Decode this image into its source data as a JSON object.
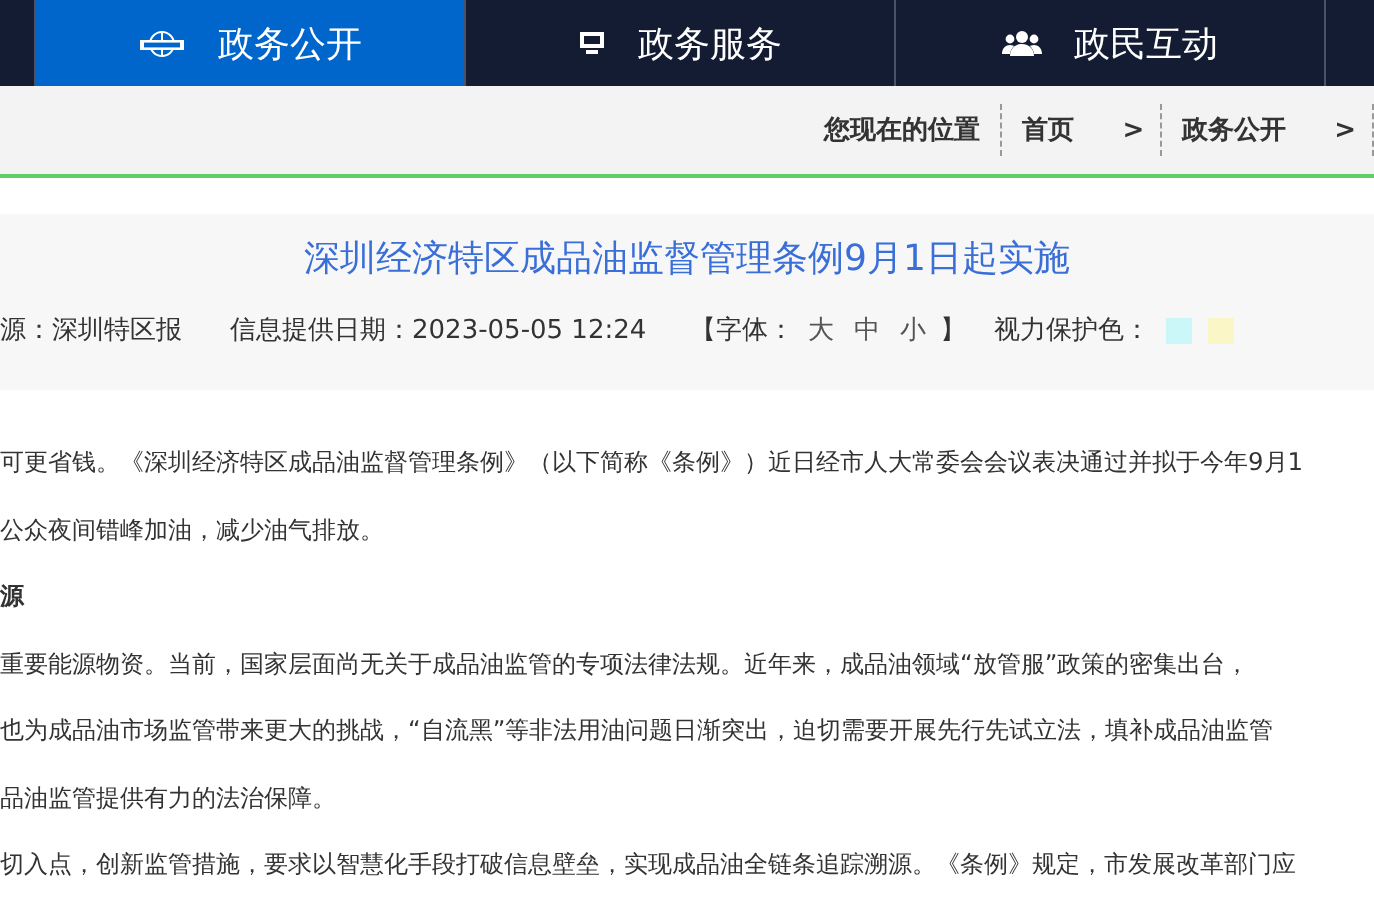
{
  "nav": {
    "tabs": [
      {
        "label": "政务公开",
        "selected": true
      },
      {
        "label": "政务服务",
        "selected": false
      },
      {
        "label": "政民互动",
        "selected": false
      }
    ]
  },
  "breadcrumb": {
    "label": "您现在的位置",
    "items": [
      "首页",
      "政务公开"
    ],
    "separator": ">"
  },
  "article": {
    "title": "深圳经济特区成品油监督管理条例9月1日起实施",
    "source": "源：深圳特区报",
    "date": "信息提供日期：2023-05-05 12:24",
    "font_size": {
      "open": "【字体：",
      "sizes": [
        "大",
        "中",
        "小"
      ],
      "close": "】"
    },
    "eye_care": {
      "label": "视力保护色：",
      "colors": [
        {
          "color": "#ccf7f9"
        },
        {
          "color": "#faf6c6"
        }
      ]
    },
    "paragraphs": [
      {
        "kind": "text",
        "text": "可更省钱。《深圳经济特区成品油监督管理条例》（以下简称《条例》）近日经市人大常委会会议表决通过并拟于今年9月1"
      },
      {
        "kind": "text",
        "text": "公众夜间错峰加油，减少油气排放。"
      },
      {
        "kind": "heading",
        "text": "源"
      },
      {
        "kind": "text",
        "text": "重要能源物资。当前，国家层面尚无关于成品油监管的专项法律法规。近年来，成品油领域“放管服”政策的密集出台，"
      },
      {
        "kind": "text",
        "text": "也为成品油市场监管带来更大的挑战，“自流黑”等非法用油问题日渐突出，迫切需要开展先行先试立法，填补成品油监管"
      },
      {
        "kind": "text",
        "text": "品油监管提供有力的法治保障。"
      },
      {
        "kind": "text",
        "text": "切入点，创新监管措施，要求以智慧化手段打破信息壁垒，实现成品油全链条追踪溯源。《条例》规定，市发展改革部门应"
      }
    ]
  }
}
